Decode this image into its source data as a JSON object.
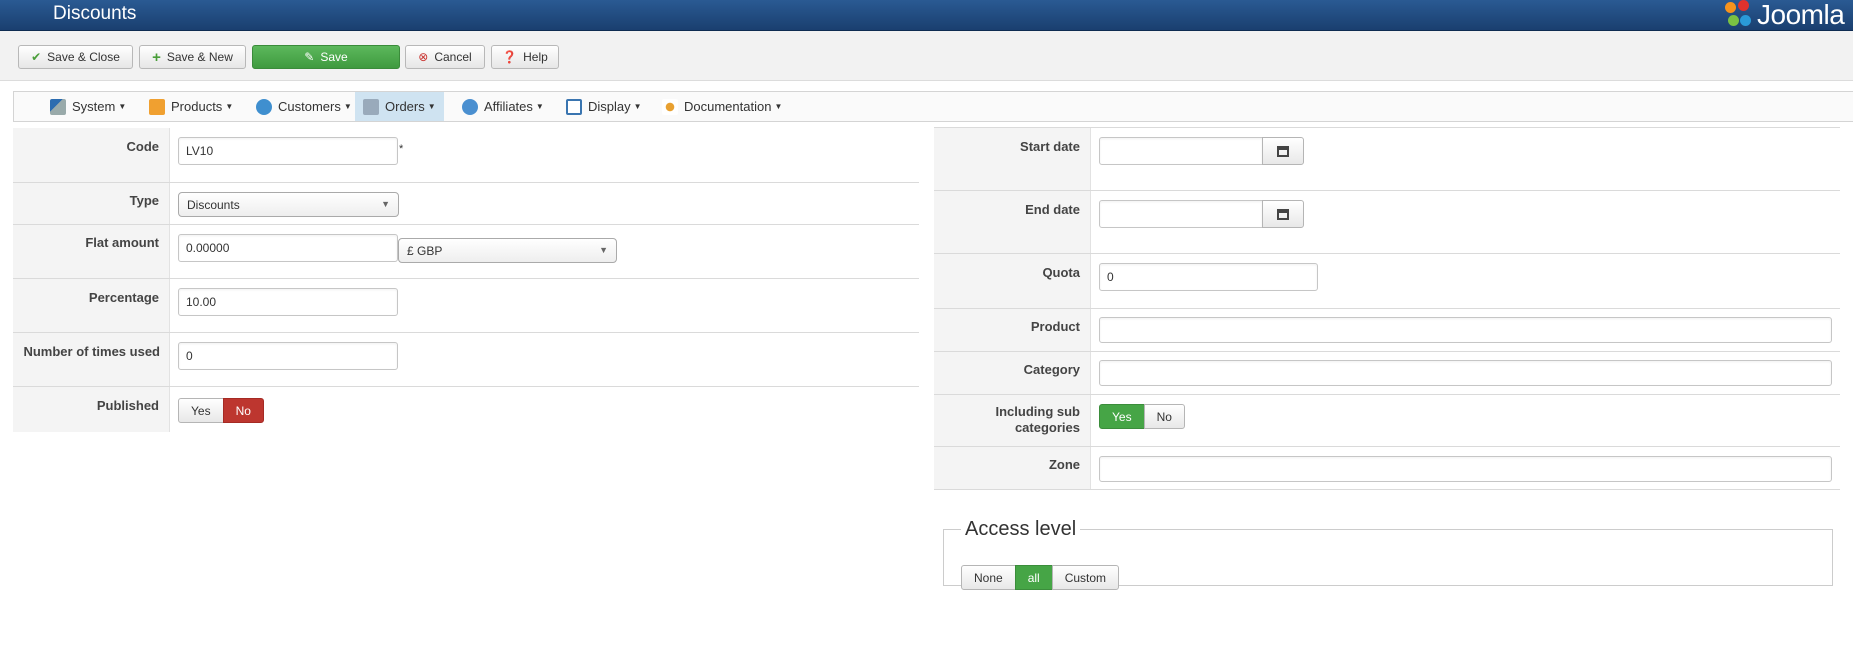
{
  "header": {
    "title": "Discounts",
    "logo_text": "Joomla"
  },
  "toolbar": {
    "save_close": "Save & Close",
    "save_new": "Save & New",
    "save": "Save",
    "cancel": "Cancel",
    "help": "Help"
  },
  "menu": {
    "items": [
      "System",
      "Products",
      "Customers",
      "Orders",
      "Affiliates",
      "Display",
      "Documentation"
    ],
    "active": "Orders"
  },
  "left_form": {
    "code": {
      "label": "Code",
      "value": "LV10",
      "required_mark": "*"
    },
    "type": {
      "label": "Type",
      "value": "Discounts"
    },
    "flat_amount": {
      "label": "Flat amount",
      "value": "0.00000",
      "currency": "£ GBP"
    },
    "percentage": {
      "label": "Percentage",
      "value": "10.00"
    },
    "times_used": {
      "label": "Number of times used",
      "value": "0"
    },
    "published": {
      "label": "Published",
      "yes": "Yes",
      "no": "No",
      "selected": "No"
    }
  },
  "right_form": {
    "start_date": {
      "label": "Start date",
      "value": ""
    },
    "end_date": {
      "label": "End date",
      "value": ""
    },
    "quota": {
      "label": "Quota",
      "value": "0"
    },
    "product": {
      "label": "Product",
      "value": ""
    },
    "category": {
      "label": "Category",
      "value": ""
    },
    "including_sub": {
      "label_line1": "Including sub",
      "label_line2": "categories",
      "yes": "Yes",
      "no": "No",
      "selected": "Yes"
    },
    "zone": {
      "label": "Zone",
      "value": ""
    }
  },
  "access_level": {
    "legend": "Access level",
    "options": [
      "None",
      "all",
      "Custom"
    ],
    "selected": "all"
  },
  "colors": {
    "header": "#1f4a80",
    "save_green": "#4aa84a",
    "active_red": "#bd362f",
    "active_green": "#46a546",
    "menu_active": "#cfe3f1"
  }
}
